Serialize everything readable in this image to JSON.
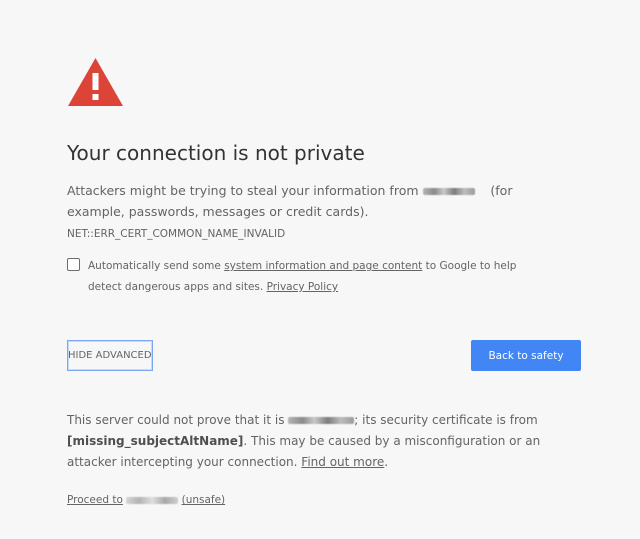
{
  "icon": {
    "name": "warning-triangle-icon",
    "color": "#db4437"
  },
  "heading": "Your connection is not private",
  "description": {
    "before_host": "Attackers might be trying to steal your information from",
    "after_host": "(for example, passwords, messages or credit cards).",
    "error_code": "NET::ERR_CERT_COMMON_NAME_INVALID"
  },
  "report": {
    "text_before_link": "Automatically send some",
    "link": "system information and page content",
    "text_after_link": "to Google to help detect dangerous apps and sites.",
    "privacy_link": "Privacy Policy"
  },
  "buttons": {
    "hide_advanced": "HIDE ADVANCED",
    "back_to_safety": "Back to safety"
  },
  "details": {
    "part1": "This server could not prove that it is",
    "part2": "; its security certificate is from",
    "issuer": "[missing_subjectAltName]",
    "part3": ". This may be caused by a misconfiguration or an attacker intercepting your connection.",
    "find_out_more": "Find out more",
    "end": "."
  },
  "proceed": {
    "prefix": "Proceed to",
    "suffix": "(unsafe)"
  },
  "colors": {
    "accent": "#4285f4",
    "danger": "#db4437",
    "background": "#f7f7f7"
  }
}
